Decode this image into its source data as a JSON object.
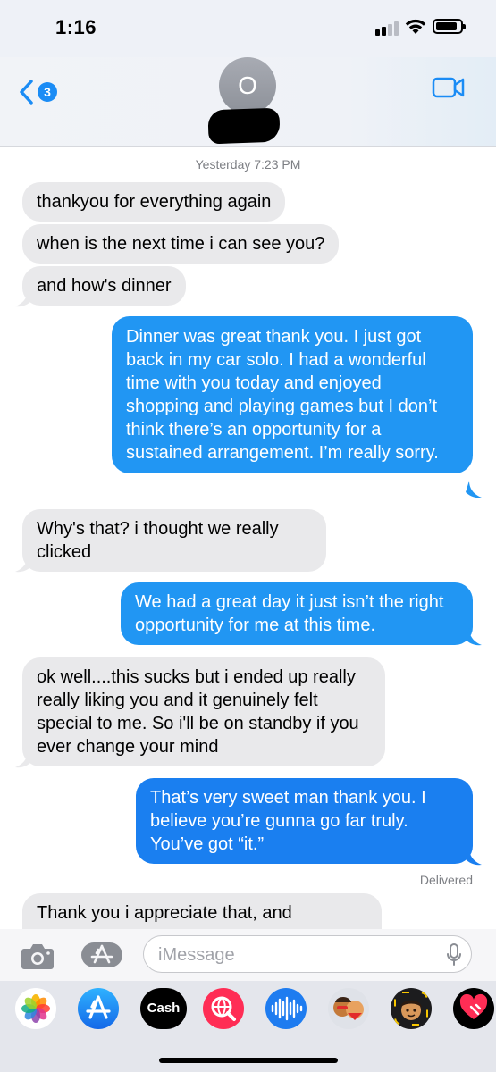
{
  "status_bar": {
    "time": "1:16",
    "battery_level": 0.9,
    "signal_bars": 2
  },
  "nav": {
    "back_badge": "3",
    "avatar_initial": "O",
    "contact_name_redacted": true
  },
  "thread": {
    "timestamp": "Yesterday 7:23 PM",
    "messages": [
      {
        "direction": "incoming",
        "text": "thankyou for everything again"
      },
      {
        "direction": "incoming",
        "text": "when is the next time i can see you?"
      },
      {
        "direction": "incoming",
        "text": "and how's dinner"
      },
      {
        "direction": "outgoing",
        "text": "Dinner was great thank you. I just got back in my car solo. I had a wonderful time with you today and enjoyed shopping and playing games but I don’t think there’s an opportunity for a sustained arrangement. I’m really sorry."
      },
      {
        "direction": "incoming",
        "text": "Why's that? i thought we really clicked"
      },
      {
        "direction": "outgoing",
        "text": "We had a great day it just isn’t the right opportunity for me at this time."
      },
      {
        "direction": "incoming",
        "text": "ok well....this sucks but i ended up really really liking you and it genuinely felt special to me. So i'll be on standby if you ever change your mind"
      },
      {
        "direction": "outgoing",
        "text": "That’s very sweet man thank you. I believe you’re gunna go far truly. You’ve got “it.”"
      },
      {
        "direction": "incoming",
        "text": "Thank you i appreciate that, and"
      }
    ],
    "delivered_label": "Delivered"
  },
  "composer": {
    "placeholder": "iMessage",
    "value": ""
  },
  "app_drawer": {
    "apps": [
      {
        "name": "photos-app-icon"
      },
      {
        "name": "app-store-app-icon"
      },
      {
        "name": "cash-app-icon",
        "label": "Cash"
      },
      {
        "name": "search-images-app-icon"
      },
      {
        "name": "audio-message-app-icon"
      },
      {
        "name": "memoji-stickers-app-icon"
      },
      {
        "name": "animoji-app-icon"
      },
      {
        "name": "digital-touch-app-icon"
      }
    ]
  },
  "colors": {
    "outgoing_bubble": "#2196f3",
    "incoming_bubble": "#e9e9eb",
    "accent": "#1b8cf5"
  }
}
